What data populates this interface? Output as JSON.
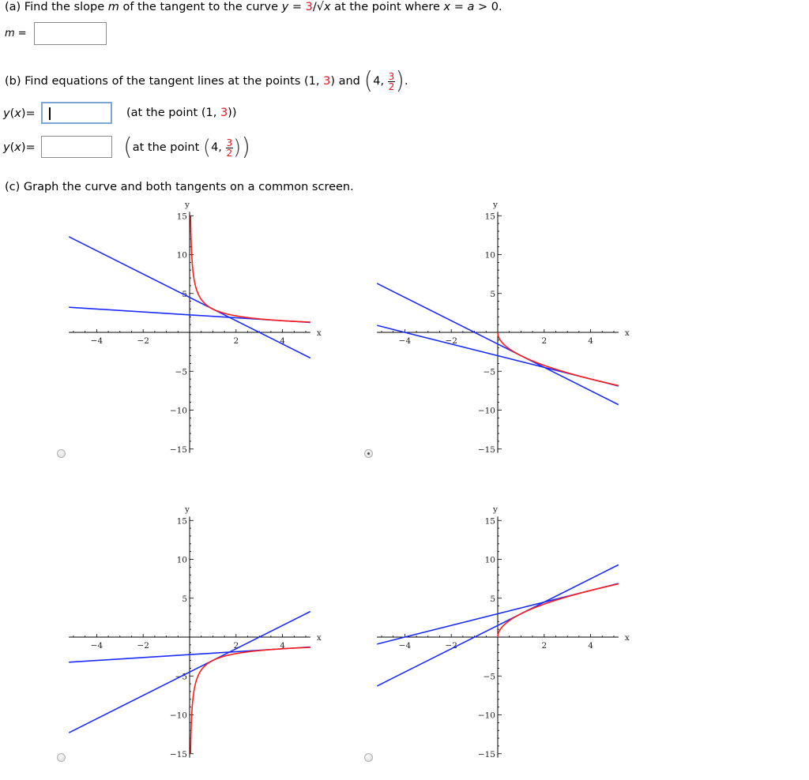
{
  "part_a": {
    "prefix": "(a) Find the slope ",
    "var_m": "m",
    "mid": " of the tangent to the curve  ",
    "eq_y": "y",
    "eq_eq": " = ",
    "eq_num": "3",
    "eq_rest": "/√",
    "eq_x": "x",
    "tail1": "  at the point where ",
    "cond_x": "x",
    "cond_mid": " = ",
    "cond_a": "a",
    "cond_end": " > 0.",
    "answer_label_var": "m",
    "answer_label_eq": " =",
    "answer_value": ""
  },
  "part_b": {
    "prompt": "(b) Find equations of the tangent lines at the points (1, ",
    "p1_y": "3",
    "mid": ") and ",
    "p2_x": "4, ",
    "p2_num": "3",
    "p2_den": "2",
    "end": ".",
    "rows": [
      {
        "label_y": "y",
        "label_rest": "(",
        "label_x": "x",
        "label_end": ")=",
        "value": "",
        "note_pre": "(at the point (1, ",
        "note_red": "3",
        "note_post": "))"
      },
      {
        "label_y": "y",
        "label_rest": "(",
        "label_x": "x",
        "label_end": ")=",
        "value": "",
        "note_pre": "at the point ",
        "note_x": "4, ",
        "note_num": "3",
        "note_den": "2"
      }
    ]
  },
  "part_c": {
    "prompt": "(c) Graph the curve and both tangents on a common screen."
  },
  "colors": {
    "curve": "#ff1a1a",
    "tangent": "#1a2bff",
    "highlight": "#e8141c"
  },
  "chart_data": [
    {
      "type": "line",
      "id": "option-1",
      "selected": false,
      "xlabel": "x",
      "ylabel": "y",
      "xlim": [
        -5.2,
        5.2
      ],
      "ylim": [
        -15.5,
        15.5
      ],
      "xticks": [
        -4,
        -2,
        2,
        4
      ],
      "yticks": [
        15,
        10,
        5,
        -5,
        -10,
        -15
      ],
      "curve": {
        "name": "y = 3/sqrt(x)",
        "sign": 1,
        "kind": "inv_sqrt",
        "domain": [
          0.04,
          5.2
        ]
      },
      "tangents": [
        {
          "name": "tangent at (1,3)",
          "slope": -1.5,
          "intercept": 4.5
        },
        {
          "name": "tangent at (4,1.5)",
          "slope": -0.1875,
          "intercept": 2.25
        }
      ]
    },
    {
      "type": "line",
      "id": "option-2",
      "selected": true,
      "xlabel": "x",
      "ylabel": "y",
      "xlim": [
        -5.2,
        5.2
      ],
      "ylim": [
        -15.5,
        15.5
      ],
      "xticks": [
        -4,
        -2,
        2,
        4
      ],
      "yticks": [
        15,
        10,
        5,
        -5,
        -10,
        -15
      ],
      "curve": {
        "name": "y = -3*sqrt(x)",
        "sign": -1,
        "kind": "sqrt",
        "domain": [
          0,
          5.2
        ]
      },
      "tangents": [
        {
          "name": "tangent at (1,-3)",
          "slope": -1.5,
          "intercept": -1.5
        },
        {
          "name": "tangent at (4,-6)",
          "slope": -0.75,
          "intercept": -3
        }
      ]
    },
    {
      "type": "line",
      "id": "option-3",
      "selected": false,
      "xlabel": "x",
      "ylabel": "y",
      "xlim": [
        -5.2,
        5.2
      ],
      "ylim": [
        -15.5,
        15.5
      ],
      "xticks": [
        -4,
        -2,
        2,
        4
      ],
      "yticks": [
        15,
        10,
        5,
        -5,
        -10,
        -15
      ],
      "curve": {
        "name": "y = -3/sqrt(x)",
        "sign": -1,
        "kind": "inv_sqrt",
        "domain": [
          0.04,
          5.2
        ]
      },
      "tangents": [
        {
          "name": "tangent at (1,-3)",
          "slope": 1.5,
          "intercept": -4.5
        },
        {
          "name": "tangent at (4,-1.5)",
          "slope": 0.1875,
          "intercept": -2.25
        }
      ]
    },
    {
      "type": "line",
      "id": "option-4",
      "selected": false,
      "xlabel": "x",
      "ylabel": "y",
      "xlim": [
        -5.2,
        5.2
      ],
      "ylim": [
        -15.5,
        15.5
      ],
      "xticks": [
        -4,
        -2,
        2,
        4
      ],
      "yticks": [
        15,
        10,
        5,
        -5,
        -10,
        -15
      ],
      "curve": {
        "name": "y = 3*sqrt(x)",
        "sign": 1,
        "kind": "sqrt",
        "domain": [
          0,
          5.2
        ]
      },
      "tangents": [
        {
          "name": "tangent at (1,3)",
          "slope": 1.5,
          "intercept": 1.5
        },
        {
          "name": "tangent at (4,6)",
          "slope": 0.75,
          "intercept": 3
        }
      ]
    }
  ]
}
